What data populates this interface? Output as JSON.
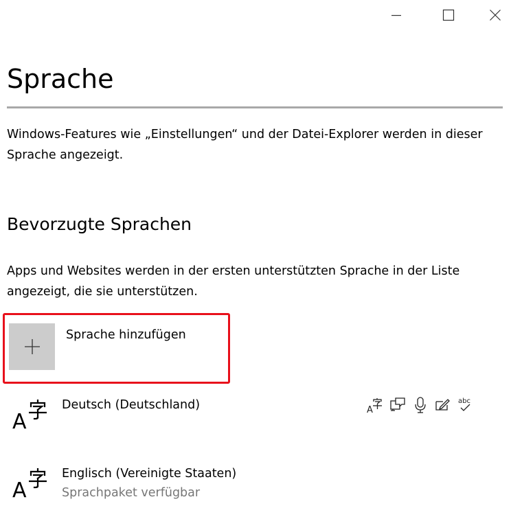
{
  "window": {
    "minimize_icon": "minimize-icon",
    "maximize_icon": "maximize-icon",
    "close_icon": "close-icon"
  },
  "header": {
    "title": "Sprache",
    "description": "Windows-Features wie „Einstellungen“ und der Datei-Explorer werden in dieser Sprache angezeigt."
  },
  "preferred": {
    "title": "Bevorzugte Sprachen",
    "description": "Apps und Websites werden in der ersten unterstützten Sprache in der Liste angezeigt, die sie unterstützen.",
    "add_button": {
      "label": "Sprache hinzufügen",
      "icon": "plus-icon"
    },
    "languages": [
      {
        "name": "Deutsch (Deutschland)",
        "status": "",
        "icon": "language-icon",
        "features": [
          "display-language-icon",
          "speech-icon",
          "microphone-icon",
          "handwriting-icon",
          "spellcheck-icon"
        ]
      },
      {
        "name": "Englisch (Vereinigte Staaten)",
        "status": "Sprachpaket verfügbar",
        "icon": "language-icon",
        "features": []
      }
    ]
  },
  "colors": {
    "highlight_border": "#e8101b",
    "plus_tile": "#cccccc",
    "secondary_text": "#767676",
    "underline": "#a8a8a8"
  }
}
